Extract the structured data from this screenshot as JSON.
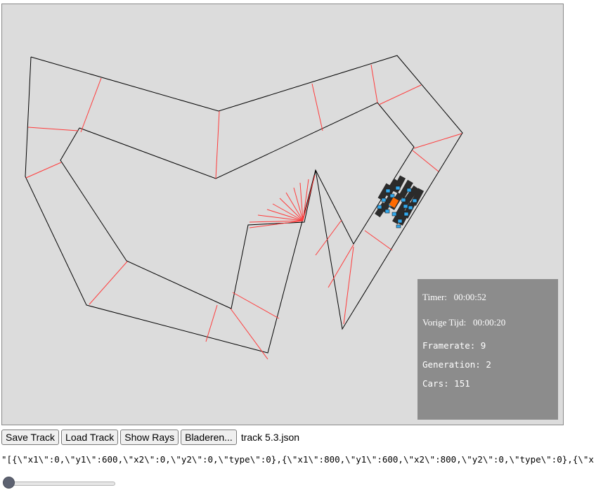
{
  "stats": {
    "timer_label": "Timer:",
    "timer_value": "00:00:52",
    "previous_time_label": "Vorige Tijd:",
    "previous_time_value": "00:00:20",
    "framerate_label": "Framerate:",
    "framerate_value": "9",
    "generation_label": "Generation:",
    "generation_value": "2",
    "cars_label": "Cars:",
    "cars_value": "151"
  },
  "toolbar": {
    "save_label": "Save Track",
    "load_label": "Load Track",
    "rays_label": "Show Rays",
    "browse_label": "Bladeren...",
    "file_name": "track 5.3.json"
  },
  "track_json_text": "\"[{\\\"x1\\\":0,\\\"y1\\\":600,\\\"x2\\\":0,\\\"y2\\\":0,\\\"type\\\":0},{\\\"x1\\\":800,\\\"y1\\\":600,\\\"x2\\\":800,\\\"y2\\\":0,\\\"type\\\":0},{\\\"x",
  "slider": {
    "value": 0
  },
  "colors": {
    "canvas_bg": "#dcdcdc",
    "wall": "#000000",
    "checkpoint": "#ff3b3b",
    "car_body": "#2b2b2b",
    "car_accent": "#33aaee",
    "best_car": "#ff6a00",
    "stats_bg": "#8c8c8c"
  }
}
